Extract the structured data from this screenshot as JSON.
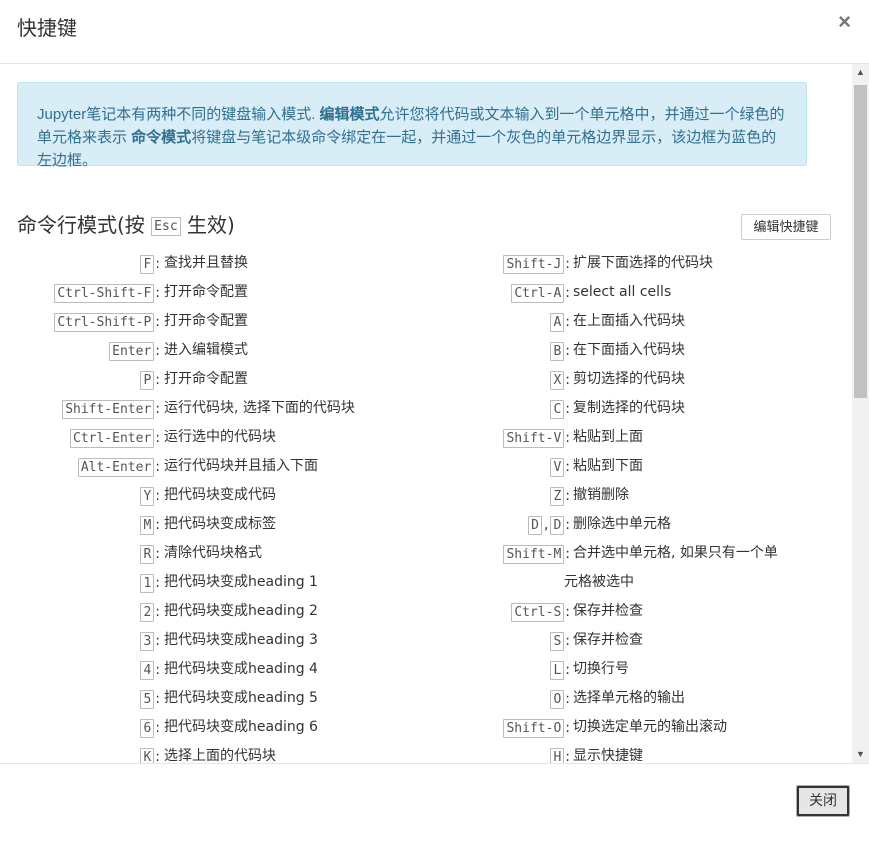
{
  "dialog": {
    "title": "快捷键",
    "close_glyph": "×",
    "close_button": "关闭"
  },
  "alert": {
    "part1": "Jupyter笔记本有两种不同的键盘输入模式. ",
    "edit_mode": "编辑模式",
    "part2": "允许您将代码或文本输入到一个单元格中，并通过一个绿色的单元格来表示 ",
    "command_mode": "命令模式",
    "part3": "将键盘与笔记本级命令绑定在一起，并通过一个灰色的单元格边界显示，该边框为蓝色的左边框。"
  },
  "section": {
    "title_prefix": "命令行模式(按 ",
    "title_key": "Esc",
    "title_suffix": " 生效)",
    "edit_shortcuts_button": "编辑快捷键"
  },
  "shortcuts_left": [
    {
      "keys": [
        "F"
      ],
      "desc": "查找并且替换"
    },
    {
      "keys": [
        "Ctrl-Shift-F"
      ],
      "desc": "打开命令配置"
    },
    {
      "keys": [
        "Ctrl-Shift-P"
      ],
      "desc": "打开命令配置"
    },
    {
      "keys": [
        "Enter"
      ],
      "desc": "进入编辑模式"
    },
    {
      "keys": [
        "P"
      ],
      "desc": "打开命令配置"
    },
    {
      "keys": [
        "Shift-Enter"
      ],
      "desc": "运行代码块, 选择下面的代码块"
    },
    {
      "keys": [
        "Ctrl-Enter"
      ],
      "desc": "运行选中的代码块"
    },
    {
      "keys": [
        "Alt-Enter"
      ],
      "desc": "运行代码块并且插入下面"
    },
    {
      "keys": [
        "Y"
      ],
      "desc": "把代码块变成代码"
    },
    {
      "keys": [
        "M"
      ],
      "desc": "把代码块变成标签"
    },
    {
      "keys": [
        "R"
      ],
      "desc": "清除代码块格式"
    },
    {
      "keys": [
        "1"
      ],
      "desc": "把代码块变成heading 1"
    },
    {
      "keys": [
        "2"
      ],
      "desc": "把代码块变成heading 2"
    },
    {
      "keys": [
        "3"
      ],
      "desc": "把代码块变成heading 3"
    },
    {
      "keys": [
        "4"
      ],
      "desc": "把代码块变成heading 4"
    },
    {
      "keys": [
        "5"
      ],
      "desc": "把代码块变成heading 5"
    },
    {
      "keys": [
        "6"
      ],
      "desc": "把代码块变成heading 6"
    },
    {
      "keys": [
        "K"
      ],
      "desc": "选择上面的代码块"
    }
  ],
  "shortcuts_right": [
    {
      "keys": [
        "Shift-J"
      ],
      "desc": "扩展下面选择的代码块"
    },
    {
      "keys": [
        "Ctrl-A"
      ],
      "desc": "select all cells"
    },
    {
      "keys": [
        "A"
      ],
      "desc": "在上面插入代码块"
    },
    {
      "keys": [
        "B"
      ],
      "desc": "在下面插入代码块"
    },
    {
      "keys": [
        "X"
      ],
      "desc": "剪切选择的代码块"
    },
    {
      "keys": [
        "C"
      ],
      "desc": "复制选择的代码块"
    },
    {
      "keys": [
        "Shift-V"
      ],
      "desc": "粘贴到上面"
    },
    {
      "keys": [
        "V"
      ],
      "desc": "粘贴到下面"
    },
    {
      "keys": [
        "Z"
      ],
      "desc": "撤销删除"
    },
    {
      "keys": [
        "D",
        "D"
      ],
      "sep": ",",
      "desc": "删除选中单元格"
    },
    {
      "keys": [
        "Shift-M"
      ],
      "desc": "合并选中单元格, 如果只有一个单",
      "desc_cont": "元格被选中"
    },
    {
      "keys": [
        "Ctrl-S"
      ],
      "desc": "保存并检查"
    },
    {
      "keys": [
        "S"
      ],
      "desc": "保存并检查"
    },
    {
      "keys": [
        "L"
      ],
      "desc": "切换行号"
    },
    {
      "keys": [
        "O"
      ],
      "desc": "选择单元格的输出"
    },
    {
      "keys": [
        "Shift-O"
      ],
      "desc": "切换选定单元的输出滚动"
    },
    {
      "keys": [
        "H"
      ],
      "desc": "显示快捷键"
    }
  ]
}
